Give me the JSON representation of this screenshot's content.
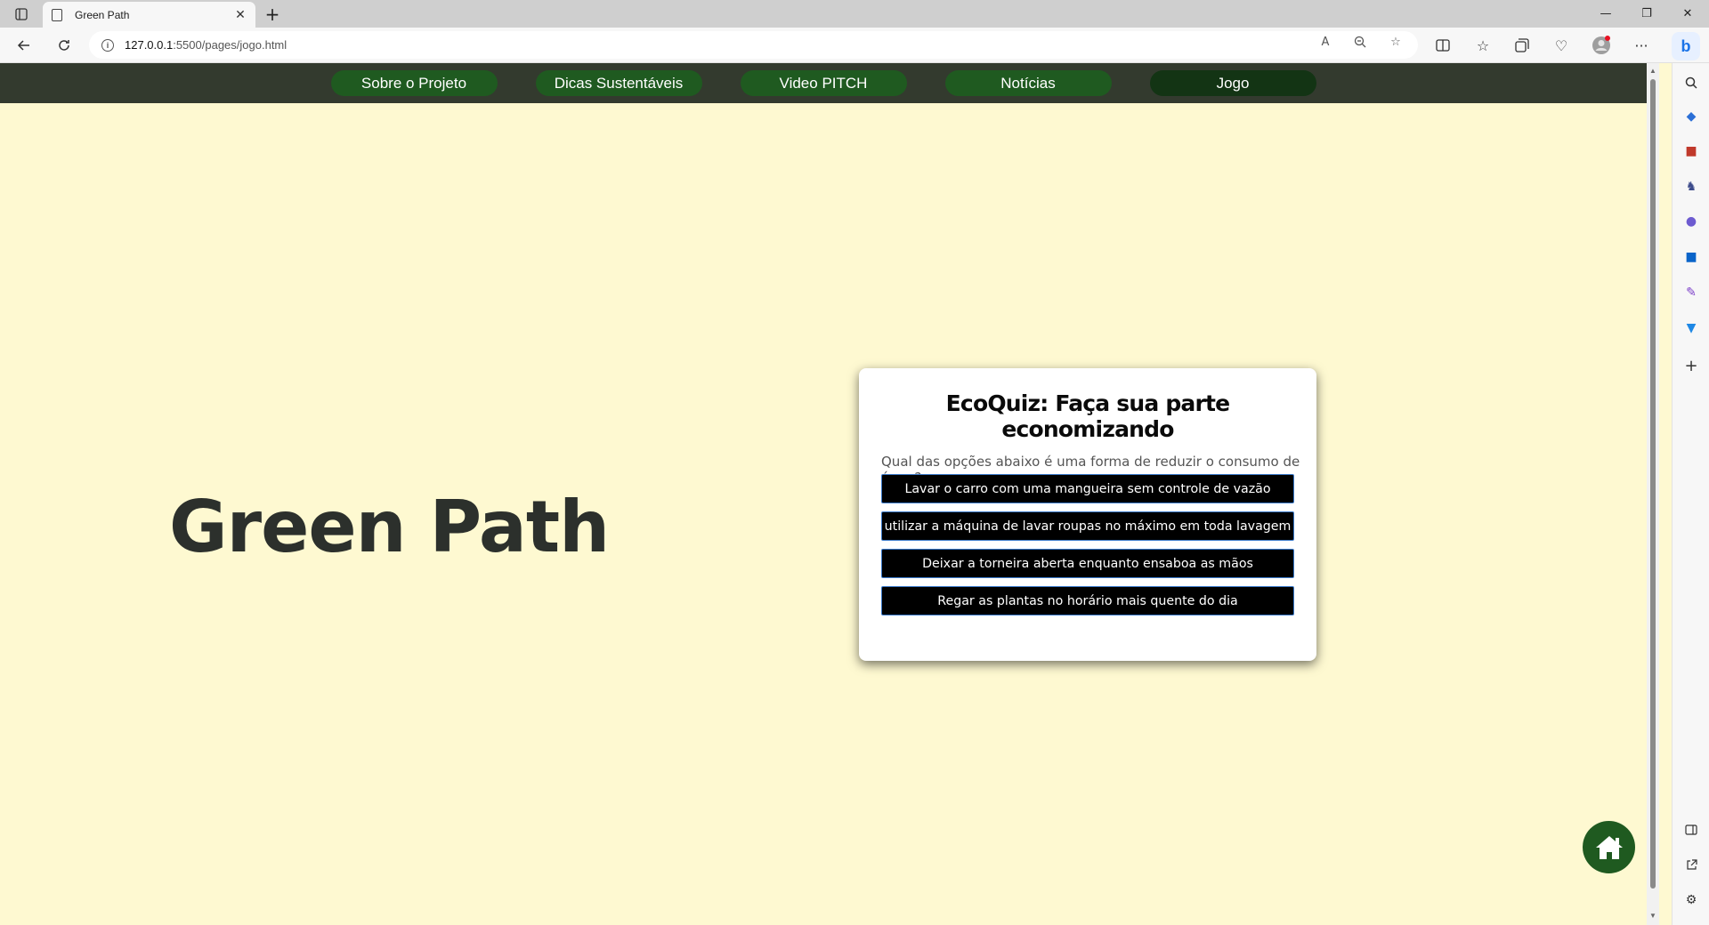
{
  "browser": {
    "tab_title": "Green Path",
    "tab_close": "✕",
    "new_tab": "+",
    "url_host": "127.0.0.1",
    "url_path": ":5500/pages/jogo.html",
    "window_controls": [
      "—",
      "❐",
      "✕"
    ],
    "toolbar_icons": [
      "back-icon",
      "refresh-icon",
      "read-aloud-icon",
      "zoom-icon",
      "favorite-icon",
      "split-screen-icon",
      "favorites-icon",
      "collections-icon",
      "browser-essentials-icon",
      "profile-icon",
      "more-icon"
    ],
    "sidebar_icons": [
      "search-icon",
      "shopping-icon",
      "tools-icon",
      "games-icon",
      "office-icon",
      "outlook-icon",
      "designer-icon",
      "drop-icon",
      "add-icon"
    ]
  },
  "nav": {
    "items": [
      {
        "label": "Sobre o Projeto"
      },
      {
        "label": "Dicas Sustentáveis"
      },
      {
        "label": "Video PITCH"
      },
      {
        "label": "Notícias"
      },
      {
        "label": "Jogo"
      }
    ],
    "active": "Jogo"
  },
  "hero": {
    "title": "Green Path"
  },
  "quiz": {
    "title": "EcoQuiz: Faça sua parte economizando",
    "question": "Qual das opções abaixo é uma forma de reduzir o consumo de água?",
    "answers": [
      "Lavar o carro com uma mangueira sem controle de vazão",
      "utilizar a máquina de lavar roupas no máximo em toda lavagem",
      "Deixar a torneira aberta enquanto ensaboa as mãos",
      "Regar as plantas no horário mais quente do dia"
    ]
  },
  "colors": {
    "page_bg": "#fef9d1",
    "nav_bg": "#333a2e",
    "nav_item": "#1f5a20",
    "nav_item_active": "#133414",
    "home_button": "#1f5a20"
  },
  "home_button": {
    "icon": "home-icon"
  }
}
